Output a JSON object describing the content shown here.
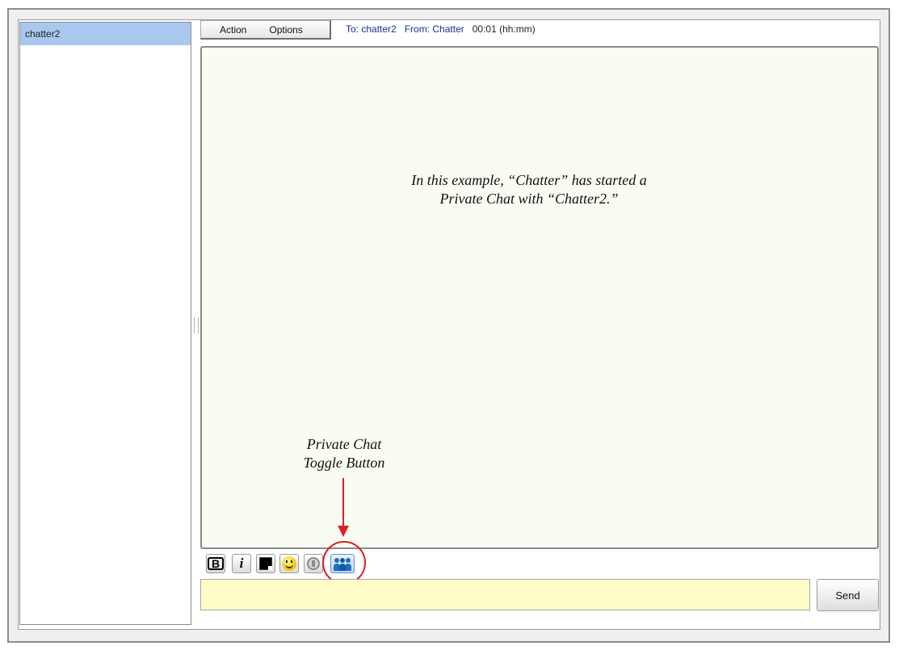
{
  "user_list": {
    "items": [
      {
        "name": "chatter2",
        "selected": true
      }
    ]
  },
  "menu": {
    "action_label": "Action",
    "options_label": "Options"
  },
  "status": {
    "to": "To: chatter2",
    "from": "From: Chatter",
    "time": "00:01 (hh:mm)"
  },
  "annotations": {
    "main_line1": "In this example, “Chatter” has started a",
    "main_line2": "Private Chat with “Chatter2.”",
    "toggle_line1": "Private Chat",
    "toggle_line2": "Toggle Button"
  },
  "toolbar": {
    "bold_label": "B",
    "italic_label": "i",
    "icons": [
      "bold-icon",
      "italic-icon",
      "text-color-icon",
      "smiley-icon",
      "sound-icon",
      "private-chat-toggle-icon"
    ]
  },
  "input": {
    "value": "",
    "placeholder": ""
  },
  "send_label": "Send",
  "colors": {
    "selected_user_bg": "#a9c7ef",
    "chat_bg": "#f9fcf2",
    "input_bg": "#fdfbc8",
    "annotation_red": "#e02020",
    "status_blue": "#1f2f8c"
  }
}
